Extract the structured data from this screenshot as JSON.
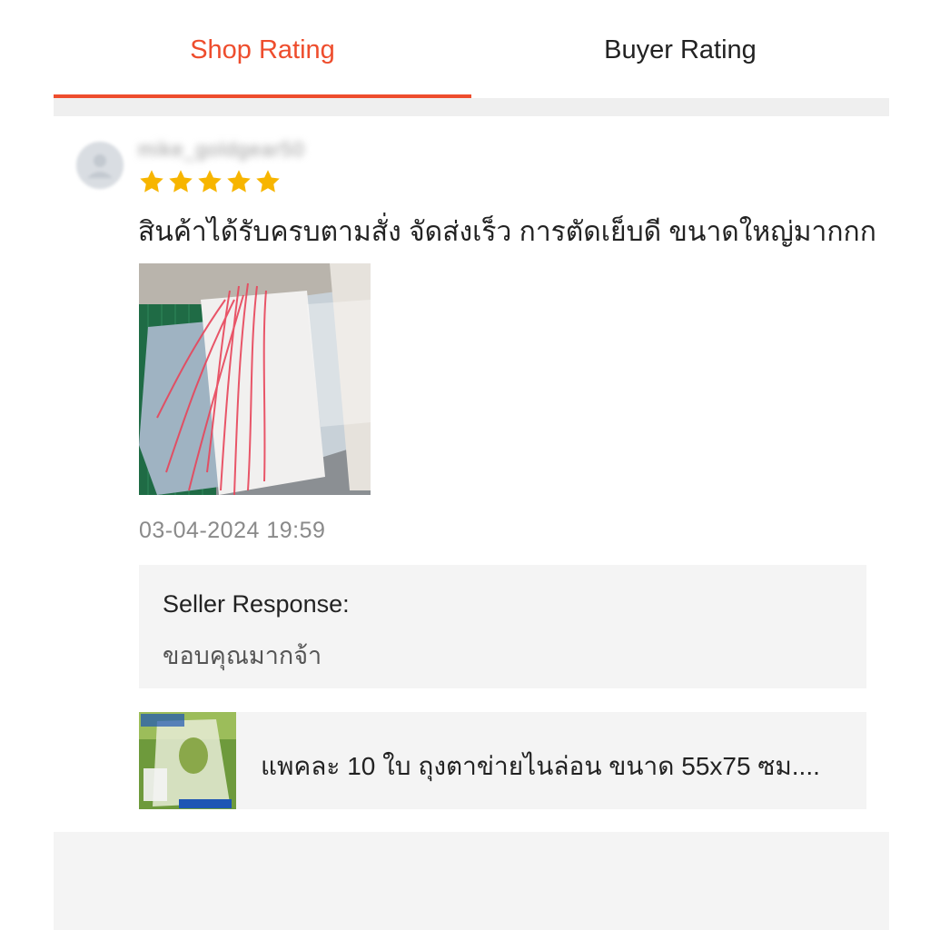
{
  "tabs": [
    {
      "label": "Shop Rating",
      "active": true
    },
    {
      "label": "Buyer Rating",
      "active": false
    }
  ],
  "colors": {
    "accent": "#ee4d2d",
    "star": "#f7b500",
    "panel": "#f4f4f4"
  },
  "review": {
    "username": "mike_goldgear50",
    "rating": 5,
    "text": "สินค้าได้รับครบตามสั่ง จัดส่งเร็ว การตัดเย็บดี ขนาดใหญ่มากกก",
    "timestamp": "03-04-2024 19:59",
    "seller_response": {
      "title": "Seller Response:",
      "text": "ขอบคุณมากจ้า"
    },
    "product": {
      "title": "แพคละ 10 ใบ ถุงตาข่ายไนล่อน ขนาด 55x75 ซม...."
    }
  }
}
